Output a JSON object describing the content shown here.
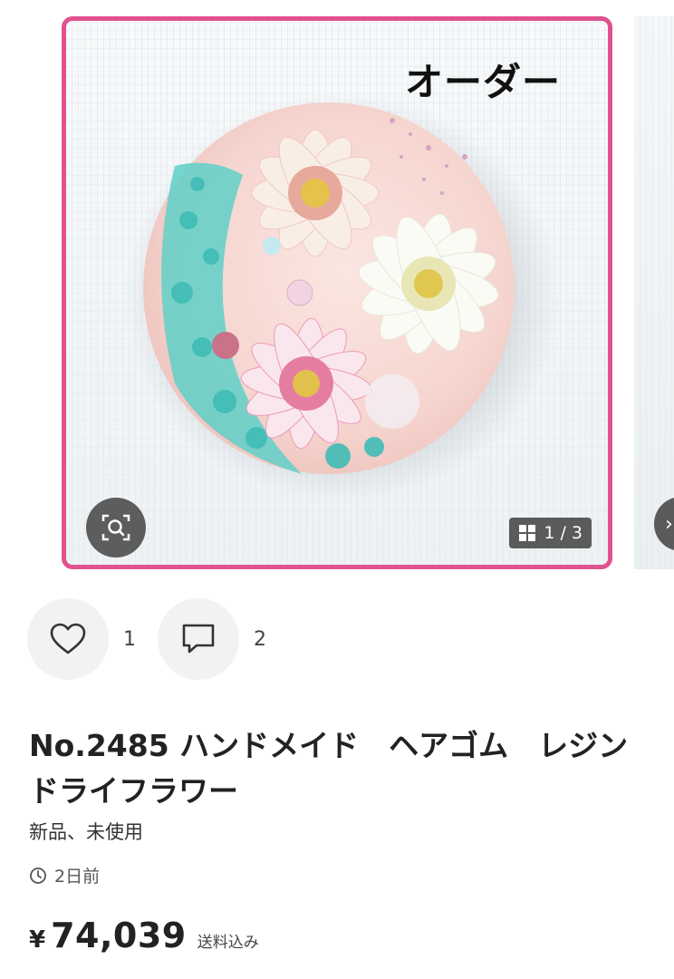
{
  "product": {
    "image_overlay_text": "オーダー",
    "page_indicator": "1 / 3",
    "likes_count": "1",
    "comments_count": "2",
    "title": "No.2485 ハンドメイド　ヘアゴム　レジン　ドライフラワー",
    "condition": "新品、未使用",
    "posted": "2日前",
    "price_currency": "¥",
    "price": "74,039",
    "shipping_note": "送料込み"
  },
  "colors": {
    "frame_border": "#e0528f",
    "overlay_button": "#505050",
    "action_button_bg": "#f2f2f2"
  },
  "icons": {
    "zoom": "zoom-search-icon",
    "gallery": "grid-icon",
    "like": "heart-icon",
    "comment": "comment-icon",
    "time": "clock-icon"
  }
}
